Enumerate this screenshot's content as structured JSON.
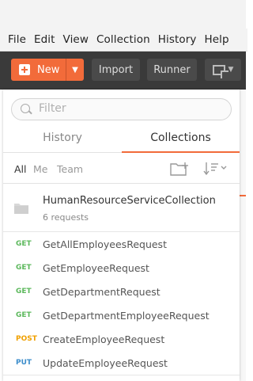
{
  "menubar": {
    "items": [
      "File",
      "Edit",
      "View",
      "Collection",
      "History",
      "Help"
    ]
  },
  "toolbar": {
    "new_label": "New",
    "import_label": "Import",
    "runner_label": "Runner"
  },
  "search": {
    "placeholder": "Filter"
  },
  "tabs": {
    "history_label": "History",
    "collections_label": "Collections"
  },
  "filters": {
    "all": "All",
    "me": "Me",
    "team": "Team"
  },
  "collection": {
    "name": "HumanResourceServiceCollection",
    "count": "6 requests"
  },
  "requests": [
    {
      "method": "GET",
      "name": "GetAllEmployeesRequest"
    },
    {
      "method": "GET",
      "name": "GetEmployeeRequest"
    },
    {
      "method": "GET",
      "name": "GetDepartmentRequest"
    },
    {
      "method": "GET",
      "name": "GetDepartmentEmployeeRequest"
    },
    {
      "method": "POST",
      "name": "CreateEmployeeRequest"
    },
    {
      "method": "PUT",
      "name": "UpdateEmployeeRequest"
    }
  ],
  "colors": {
    "accent": "#f26b3a",
    "get": "#5cb85c",
    "post": "#f0a000",
    "put": "#3c8dcb",
    "toolbar_bg": "#3a3a3a"
  }
}
